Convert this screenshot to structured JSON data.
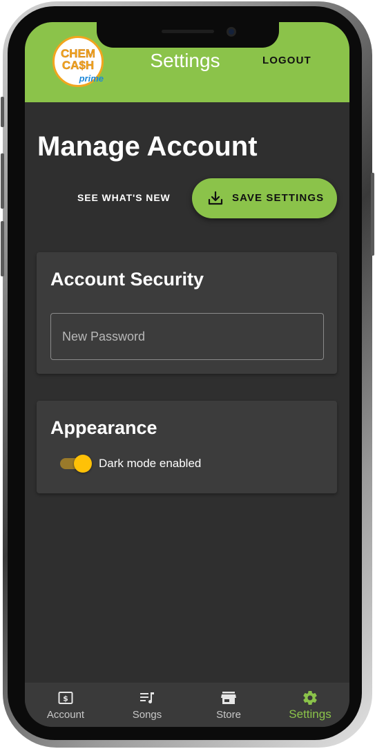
{
  "app": {
    "title": "Settings",
    "logout_label": "LOGOUT",
    "logo": {
      "line1": "CHEM",
      "line2": "CA$H",
      "sub": "prime"
    }
  },
  "page": {
    "title": "Manage Account",
    "whats_new_label": "SEE WHAT'S NEW",
    "save_label": "SAVE SETTINGS"
  },
  "security": {
    "title": "Account Security",
    "password_placeholder": "New Password",
    "password_value": ""
  },
  "appearance": {
    "title": "Appearance",
    "dark_mode_label": "Dark mode enabled",
    "dark_mode_enabled": true
  },
  "nav": {
    "items": [
      {
        "label": "Account",
        "icon": "dollar-bill-icon",
        "active": false
      },
      {
        "label": "Songs",
        "icon": "playlist-icon",
        "active": false
      },
      {
        "label": "Store",
        "icon": "store-icon",
        "active": false
      },
      {
        "label": "Settings",
        "icon": "gear-icon",
        "active": true
      }
    ]
  },
  "colors": {
    "accent": "#8bc34a",
    "background": "#2f2f2f",
    "card": "#3c3c3c",
    "toggle": "#ffc107"
  }
}
